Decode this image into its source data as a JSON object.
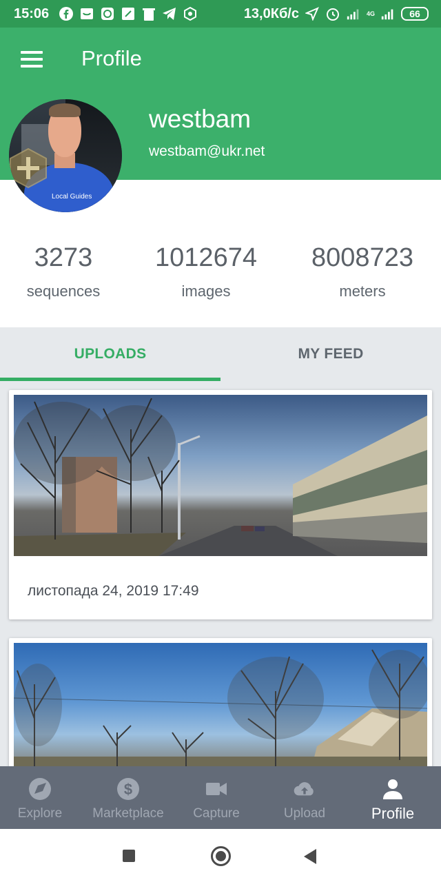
{
  "status_bar": {
    "time": "15:06",
    "network_speed": "13,0Кб/с",
    "network_type": "4G",
    "battery": "66",
    "icons": [
      "facebook-icon",
      "inbox-icon",
      "app-icon",
      "maps-icon",
      "trash-icon",
      "telegram-icon",
      "vpn-icon",
      "location-icon",
      "alarm-icon",
      "signal-icon"
    ]
  },
  "app_bar": {
    "title": "Profile"
  },
  "profile": {
    "username": "westbam",
    "email": "westbam@ukr.net",
    "avatar_shirt_text": "Local Guides"
  },
  "stats": [
    {
      "value": "3273",
      "label": "sequences"
    },
    {
      "value": "1012674",
      "label": "images"
    },
    {
      "value": "8008723",
      "label": "meters"
    }
  ],
  "tabs": [
    {
      "label": "UPLOADS",
      "active": true
    },
    {
      "label": "MY FEED",
      "active": false
    }
  ],
  "uploads": [
    {
      "date": "листопада 24, 2019 17:49"
    },
    {
      "date": ""
    }
  ],
  "bottom_nav": [
    {
      "label": "Explore",
      "icon": "compass-icon",
      "active": false
    },
    {
      "label": "Marketplace",
      "icon": "dollar-icon",
      "active": false
    },
    {
      "label": "Capture",
      "icon": "camera-icon",
      "active": false
    },
    {
      "label": "Upload",
      "icon": "cloud-upload-icon",
      "active": false
    },
    {
      "label": "Profile",
      "icon": "person-icon",
      "active": true
    }
  ],
  "colors": {
    "status_bar": "#2f9a55",
    "header": "#3cb06b",
    "accent": "#35ad64",
    "bottom_nav": "#636b78"
  }
}
